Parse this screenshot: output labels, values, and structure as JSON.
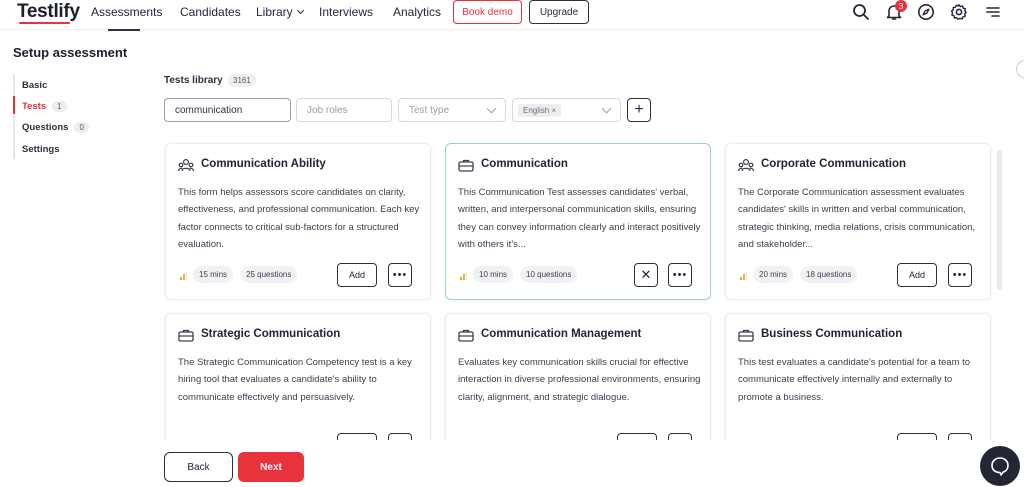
{
  "app": {
    "logo": "Testlify"
  },
  "nav": {
    "items": [
      "Assessments",
      "Candidates",
      "Library",
      "Interviews",
      "Analytics"
    ],
    "book_demo": "Book demo",
    "upgrade": "Upgrade",
    "notification_count": "3"
  },
  "page": {
    "title": "Setup assessment"
  },
  "steps": [
    {
      "label": "Basic"
    },
    {
      "label": "Tests",
      "count": "1"
    },
    {
      "label": "Questions",
      "count": "0"
    },
    {
      "label": "Settings"
    }
  ],
  "library": {
    "title": "Tests library",
    "count": "3161",
    "search_value": "communication",
    "job_roles_placeholder": "Job roles",
    "test_type_placeholder": "Test type",
    "language_chip": "English ×"
  },
  "cards": [
    {
      "title": "Communication Ability",
      "icon": "people-icon",
      "description": "This form helps assessors score candidates on clarity, effectiveness, and professional communication. Each key factor connects to critical sub-factors for a structured evaluation.",
      "duration": "15 mins",
      "questions": "25 questions",
      "action": "Add",
      "selected": false
    },
    {
      "title": "Communication",
      "icon": "briefcase-icon",
      "description": "This Communication Test assesses candidates' verbal, written, and interpersonal communication skills, ensuring they can convey information clearly and interact positively with others it's...",
      "duration": "10 mins",
      "questions": "10 questions",
      "action": "✕",
      "selected": true
    },
    {
      "title": "Corporate Communication",
      "icon": "people-icon",
      "description": "The Corporate Communication assessment evaluates candidates' skills in written and verbal communication, strategic thinking, media relations, crisis communication, and stakeholder...",
      "duration": "20 mins",
      "questions": "18 questions",
      "action": "Add",
      "selected": false
    },
    {
      "title": "Strategic Communication",
      "icon": "briefcase-icon",
      "description": "The Strategic Communication Competency test is a key hiring tool that evaluates a candidate's ability to communicate effectively and persuasively.",
      "duration": "",
      "questions": "",
      "action": "",
      "selected": false
    },
    {
      "title": "Communication Management",
      "icon": "briefcase-icon",
      "description": "Evaluates key communication skills crucial for effective interaction in diverse professional environments, ensuring clarity, alignment, and strategic dialogue.",
      "duration": "",
      "questions": "",
      "action": "",
      "selected": false
    },
    {
      "title": "Business Communication",
      "icon": "briefcase-icon",
      "description": "This test evaluates a candidate's potential for a team to communicate effectively internally and externally to promote a business.",
      "duration": "",
      "questions": "",
      "action": "",
      "selected": false
    }
  ],
  "footer": {
    "back": "Back",
    "next": "Next"
  },
  "colors": {
    "brand_red": "#e8323c",
    "selected_border": "#9fd3ba",
    "dark": "#1f2433"
  }
}
